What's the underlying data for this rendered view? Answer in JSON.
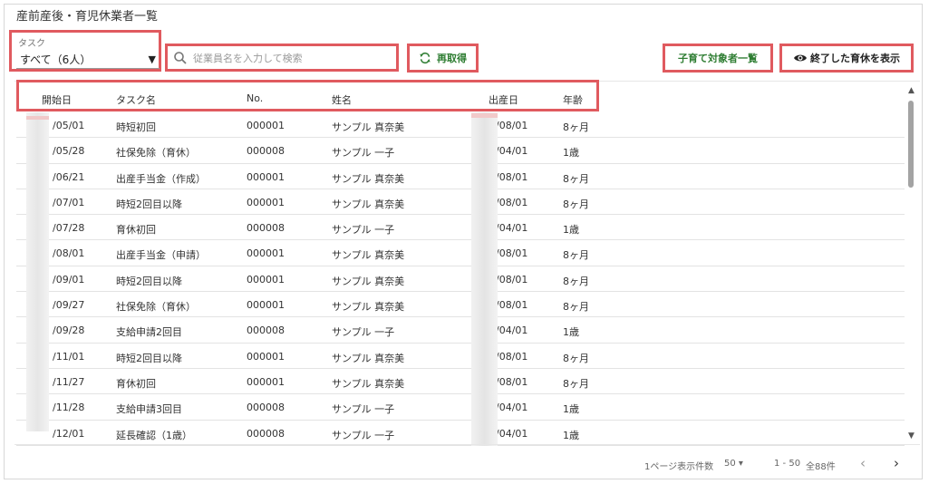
{
  "page": {
    "title": "産前産後・育児休業者一覧"
  },
  "filters": {
    "task_label": "タスク",
    "task_value": "すべて（6人）",
    "search_placeholder": "従業員名を入力して検索"
  },
  "toolbar": {
    "reload_label": "再取得",
    "kids_label": "子育て対象者一覧",
    "ended_label": "終了した育休を表示"
  },
  "table": {
    "columns": [
      "開始日",
      "タスク名",
      "No.",
      "姓名",
      "出産日",
      "年齢"
    ],
    "rows": [
      {
        "start": "/05/01",
        "task": "時短初回",
        "no": "000001",
        "name": "サンプル 真奈美",
        "birth": "/08/01",
        "age": "8ヶ月"
      },
      {
        "start": "/05/28",
        "task": "社保免除（育休）",
        "no": "000008",
        "name": "サンプル 一子",
        "birth": "/04/01",
        "age": "1歳"
      },
      {
        "start": "/06/21",
        "task": "出産手当金（作成）",
        "no": "000001",
        "name": "サンプル 真奈美",
        "birth": "/08/01",
        "age": "8ヶ月"
      },
      {
        "start": "/07/01",
        "task": "時短2回目以降",
        "no": "000001",
        "name": "サンプル 真奈美",
        "birth": "/08/01",
        "age": "8ヶ月"
      },
      {
        "start": "/07/28",
        "task": "育休初回",
        "no": "000008",
        "name": "サンプル 一子",
        "birth": "/04/01",
        "age": "1歳"
      },
      {
        "start": "/08/01",
        "task": "出産手当金（申請）",
        "no": "000001",
        "name": "サンプル 真奈美",
        "birth": "/08/01",
        "age": "8ヶ月"
      },
      {
        "start": "/09/01",
        "task": "時短2回目以降",
        "no": "000001",
        "name": "サンプル 真奈美",
        "birth": "/08/01",
        "age": "8ヶ月"
      },
      {
        "start": "/09/27",
        "task": "社保免除（育休）",
        "no": "000001",
        "name": "サンプル 真奈美",
        "birth": "/08/01",
        "age": "8ヶ月"
      },
      {
        "start": "/09/28",
        "task": "支給申請2回目",
        "no": "000008",
        "name": "サンプル 一子",
        "birth": "/04/01",
        "age": "1歳"
      },
      {
        "start": "/11/01",
        "task": "時短2回目以降",
        "no": "000001",
        "name": "サンプル 真奈美",
        "birth": "/08/01",
        "age": "8ヶ月"
      },
      {
        "start": "/11/27",
        "task": "育休初回",
        "no": "000001",
        "name": "サンプル 真奈美",
        "birth": "/08/01",
        "age": "8ヶ月"
      },
      {
        "start": "/11/28",
        "task": "支給申請3回目",
        "no": "000008",
        "name": "サンプル 一子",
        "birth": "/04/01",
        "age": "1歳"
      },
      {
        "start": "/12/01",
        "task": "延長確認（1歳）",
        "no": "000008",
        "name": "サンプル 一子",
        "birth": "/04/01",
        "age": "1歳"
      }
    ]
  },
  "footer": {
    "per_page_label": "1ページ表示件数",
    "per_page_value": "50",
    "range": "1 - 50",
    "total": "全88件"
  },
  "colors": {
    "accent_green": "#2e7d32",
    "highlight_red": "#e05a5f"
  },
  "icons": [
    "search-icon",
    "reload-icon",
    "eye-icon",
    "chevron-left-icon",
    "chevron-right-icon",
    "dropdown-caret-icon"
  ]
}
